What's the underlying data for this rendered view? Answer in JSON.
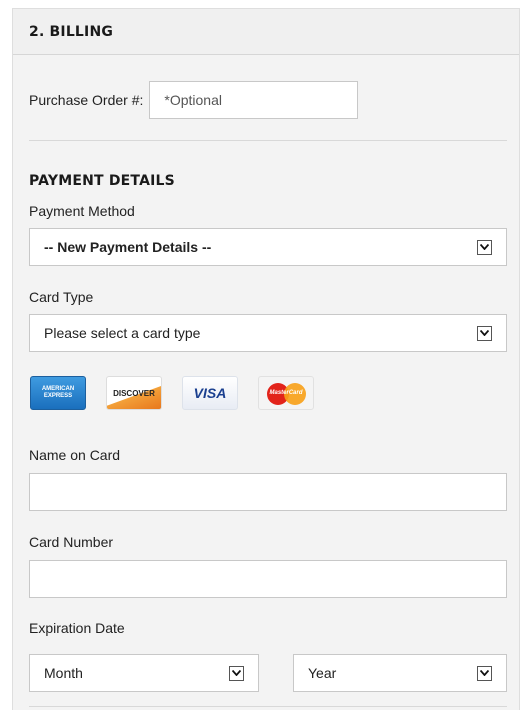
{
  "section": {
    "title": "2. BILLING"
  },
  "purchase_order": {
    "label": "Purchase Order #:",
    "placeholder": "*Optional"
  },
  "payment_details": {
    "title": "PAYMENT DETAILS",
    "payment_method": {
      "label": "Payment Method",
      "selected": "-- New Payment Details --"
    },
    "card_type": {
      "label": "Card Type",
      "selected": "Please select a card type"
    },
    "card_logos": [
      {
        "name": "american-express",
        "text": "AMERICAN EXPRESS"
      },
      {
        "name": "discover",
        "text": "DISCOVER"
      },
      {
        "name": "visa",
        "text": "VISA"
      },
      {
        "name": "mastercard",
        "text": "MasterCard"
      }
    ],
    "name_on_card": {
      "label": "Name on Card",
      "value": ""
    },
    "card_number": {
      "label": "Card Number",
      "value": ""
    },
    "expiration": {
      "label": "Expiration Date",
      "month": "Month",
      "year": "Year"
    }
  },
  "colors": {
    "panel_bg": "#f3f3f3",
    "border": "#c8c8c8",
    "visa_blue": "#1a3f8f"
  }
}
